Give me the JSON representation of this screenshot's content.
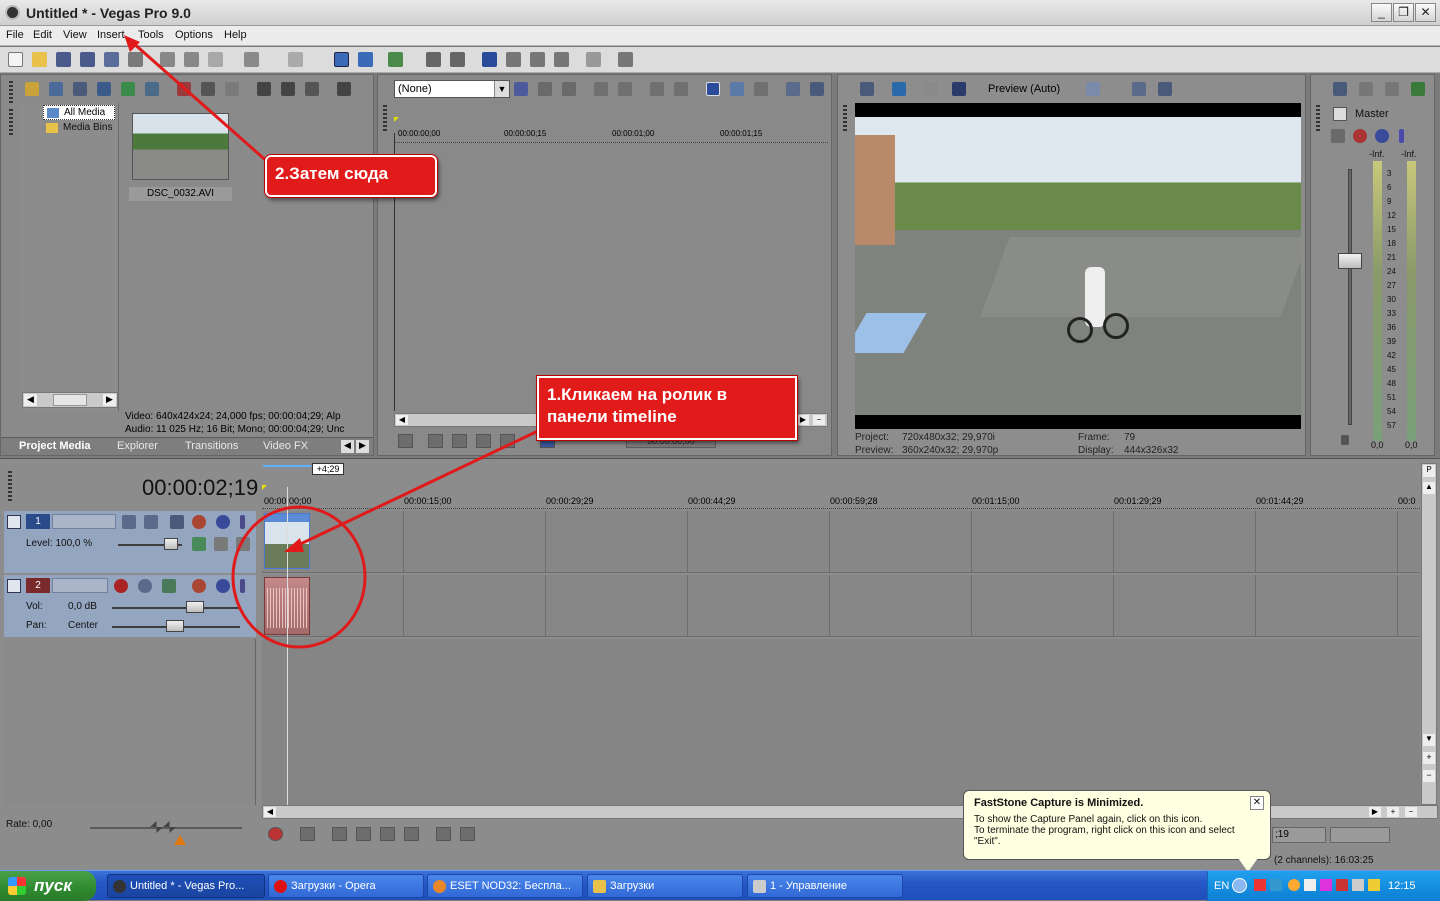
{
  "window": {
    "title": "Untitled * - Vegas Pro 9.0"
  },
  "menu": [
    "File",
    "Edit",
    "View",
    "Insert",
    "Tools",
    "Options",
    "Help"
  ],
  "project_media": {
    "tree": [
      "All Media",
      "Media Bins"
    ],
    "file_name": "DSC_0032.AVI",
    "video_info": "Video: 640x424x24; 24,000 fps; 00:00:04;29; Alp",
    "audio_info": "Audio: 11 025 Hz; 16 Bit; Mono; 00:00:04;29; Unc",
    "tabs": [
      "Project Media",
      "Explorer",
      "Transitions",
      "Video FX"
    ]
  },
  "trimmer": {
    "dropdown_value": "(None)",
    "ruler": [
      "00:00:00;00",
      "00:00:00;15",
      "00:00:01;00",
      "00:00:01;15"
    ],
    "timecode": "00:00:00;00"
  },
  "preview": {
    "mode": "Preview (Auto)",
    "project_label": "Project:",
    "project_value": "720x480x32; 29,970i",
    "preview_label": "Preview:",
    "preview_value": "360x240x32; 29,970p",
    "frame_label": "Frame:",
    "frame_value": "79",
    "display_label": "Display:",
    "display_value": "444x326x32"
  },
  "mixer": {
    "title": "Master",
    "left_db": "-Inf.",
    "right_db": "-Inf.",
    "scale": [
      "3",
      "6",
      "9",
      "12",
      "15",
      "18",
      "21",
      "24",
      "27",
      "30",
      "33",
      "36",
      "39",
      "42",
      "45",
      "48",
      "51",
      "54",
      "57"
    ],
    "bottom_left": "0,0",
    "bottom_right": "0,0"
  },
  "timeline": {
    "timecode": "00:00:02;19",
    "offset": "+4;29",
    "ruler": [
      "00:00:00;00",
      "00:00:15;00",
      "00:00:29;29",
      "00:00:44;29",
      "00:00:59;28",
      "00:01:15;00",
      "00:01:29;29",
      "00:01:44;29",
      "00:0"
    ],
    "video_track": {
      "number": "1",
      "level_label": "Level: 100,0 %"
    },
    "audio_track": {
      "number": "2",
      "vol_label": "Vol:",
      "vol_value": "0,0 dB",
      "pan_label": "Pan:",
      "pan_value": "Center"
    },
    "rate": "Rate: 0,00",
    "partial_timecode": ";19",
    "status_partial": "(2 channels): 16:03:25"
  },
  "annotations": {
    "callout1": "1.Кликаем на ролик в панели timeline",
    "callout2": "2.Затем сюда"
  },
  "balloon": {
    "title": "FastStone Capture is Minimized.",
    "line1": "To show the Capture Panel again, click on this icon.",
    "line2": "To terminate the program, right click on this icon and select \"Exit\"."
  },
  "taskbar": {
    "start": "пуск",
    "tasks": [
      "Untitled * - Vegas Pro...",
      "Загрузки - Opera",
      "ESET NOD32: Бесплa...",
      "Загрузки",
      "1 - Управление"
    ],
    "lang": "EN",
    "clock": "12:15"
  }
}
